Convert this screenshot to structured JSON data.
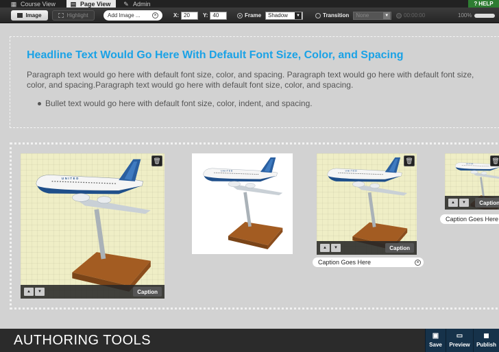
{
  "nav": {
    "tabs": [
      {
        "label": "Course View",
        "icon": "grid-icon",
        "active": false
      },
      {
        "label": "Page View",
        "icon": "page-icon",
        "active": true
      },
      {
        "label": "Admin",
        "icon": "wrench-icon",
        "active": false
      }
    ],
    "help_label": "HELP"
  },
  "toolbar": {
    "image_label": "Image",
    "highlight_label": "Highlight",
    "add_image_placeholder": "Add Image ...",
    "x_label": "X:",
    "x_value": "20",
    "y_label": "Y:",
    "y_value": "40",
    "frame_label": "Frame",
    "frame_value": "Shadow",
    "transition_label": "Transition",
    "transition_value": "None",
    "timecode": "00:00:00",
    "zoom": "100%"
  },
  "content": {
    "headline": "Headline Text Would Go Here With Default Font Size, Color, and Spacing",
    "paragraph": "Paragraph text would go here with default font size, color, and spacing. Paragraph text would go here with default font size, color, and spacing.Paragraph text would go here with default font size, color, and spacing.",
    "bullet": "Bullet text would go here with default font size, color, indent, and spacing."
  },
  "gallery": {
    "cards": [
      {
        "caption_button": "Caption"
      },
      {},
      {
        "caption_button": "Caption",
        "caption_field": "Caption Goes Here"
      },
      {
        "caption_button": "Caption",
        "caption_field": "Caption Goes Here"
      }
    ]
  },
  "bottom": {
    "brand": "AUTHORING TOOLS",
    "actions": [
      {
        "label": "Save",
        "icon": "save-icon"
      },
      {
        "label": "Preview",
        "icon": "preview-icon"
      },
      {
        "label": "Publish",
        "icon": "publish-icon"
      }
    ]
  },
  "colors": {
    "headline": "#1aa2e6",
    "canvas": "#d2d2d2",
    "help": "#2e7d32",
    "action_bar": "#16324a"
  }
}
